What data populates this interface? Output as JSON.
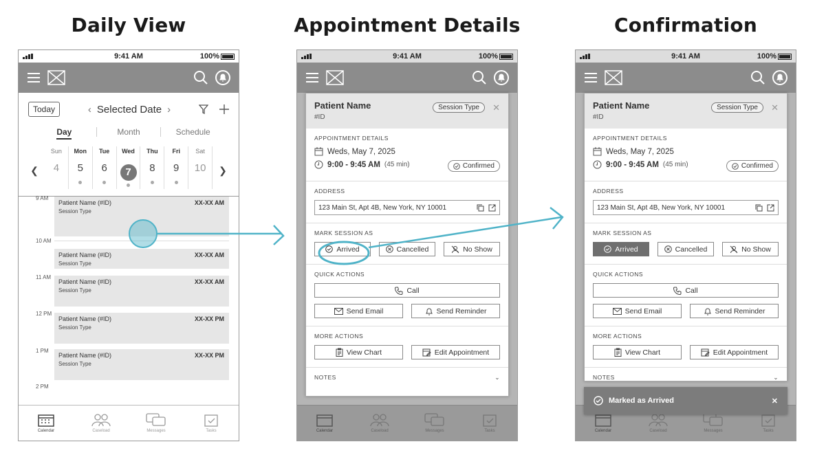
{
  "titles": [
    "Daily View",
    "Appointment Details",
    "Confirmation"
  ],
  "status": {
    "time": "9:41 AM",
    "battery": "100%"
  },
  "daily": {
    "today": "Today",
    "selected_date": "Selected Date",
    "tabs": [
      "Day",
      "Month",
      "Schedule"
    ],
    "week": [
      {
        "d": "Sun",
        "n": "4"
      },
      {
        "d": "Mon",
        "n": "5"
      },
      {
        "d": "Tue",
        "n": "6"
      },
      {
        "d": "Wed",
        "n": "7"
      },
      {
        "d": "Thu",
        "n": "8"
      },
      {
        "d": "Fri",
        "n": "9"
      },
      {
        "d": "Sat",
        "n": "10"
      }
    ],
    "times": [
      "9 AM",
      "10 AM",
      "11 AM",
      "12 PM",
      "1 PM",
      "2 PM"
    ],
    "appointments": [
      {
        "name": "Patient Name (#ID)",
        "type": "Session Type",
        "time": "XX-XX AM"
      },
      {
        "name": "Patient Name (#ID)",
        "type": "Session Type",
        "time": "XX-XX AM"
      },
      {
        "name": "Patient Name (#ID)",
        "type": "Session Type",
        "time": "XX-XX AM"
      },
      {
        "name": "Patient Name (#ID)",
        "type": "Session Type",
        "time": "XX-XX PM"
      },
      {
        "name": "Patient Name (#ID)",
        "type": "Session Type",
        "time": "XX-XX PM"
      }
    ]
  },
  "nav": [
    "Calendar",
    "Caseload",
    "Messages",
    "Tasks"
  ],
  "details": {
    "patient": "Patient Name",
    "id": "#ID",
    "session_type": "Session Type",
    "sec_appt": "APPOINTMENT DETAILS",
    "date": "Weds, May 7, 2025",
    "time": "9:00 - 9:45 AM",
    "duration": "(45 min)",
    "confirmed": "Confirmed",
    "sec_addr": "ADDRESS",
    "address": "123 Main St, Apt 4B, New York, NY 10001",
    "sec_mark": "MARK SESSION AS",
    "arrived": "Arrived",
    "cancelled": "Cancelled",
    "noshow": "No Show",
    "sec_quick": "QUICK ACTIONS",
    "call": "Call",
    "email": "Send Email",
    "reminder": "Send Reminder",
    "sec_more": "MORE ACTIONS",
    "chart": "View Chart",
    "edit": "Edit Appointment",
    "notes": "NOTES"
  },
  "toast": "Marked as Arrived",
  "colors": {
    "accent": "#4fb3c8"
  }
}
